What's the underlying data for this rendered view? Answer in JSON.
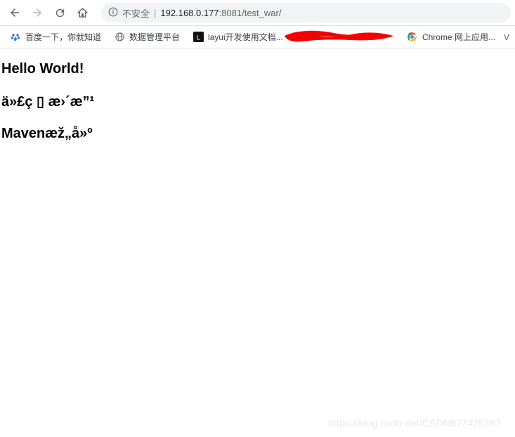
{
  "toolbar": {
    "insecure_label": "不安全",
    "url_ip": "192.168.0.177",
    "url_port": ":8081",
    "url_path": "/test_war/"
  },
  "bookmarks": {
    "b1": "百度一下，你就知道",
    "b2": "数据管理平台",
    "b3": "layui开发使用文档...",
    "b4": "Chrome 网上应用...",
    "b5_trunc": "V"
  },
  "page": {
    "h1": "Hello World!",
    "h2": "ä»£ç ▯ æ›´æ”¹",
    "h3": "Mavenæž„å»º"
  },
  "watermark": "https://blog.csdn.net/CSDN877425287"
}
